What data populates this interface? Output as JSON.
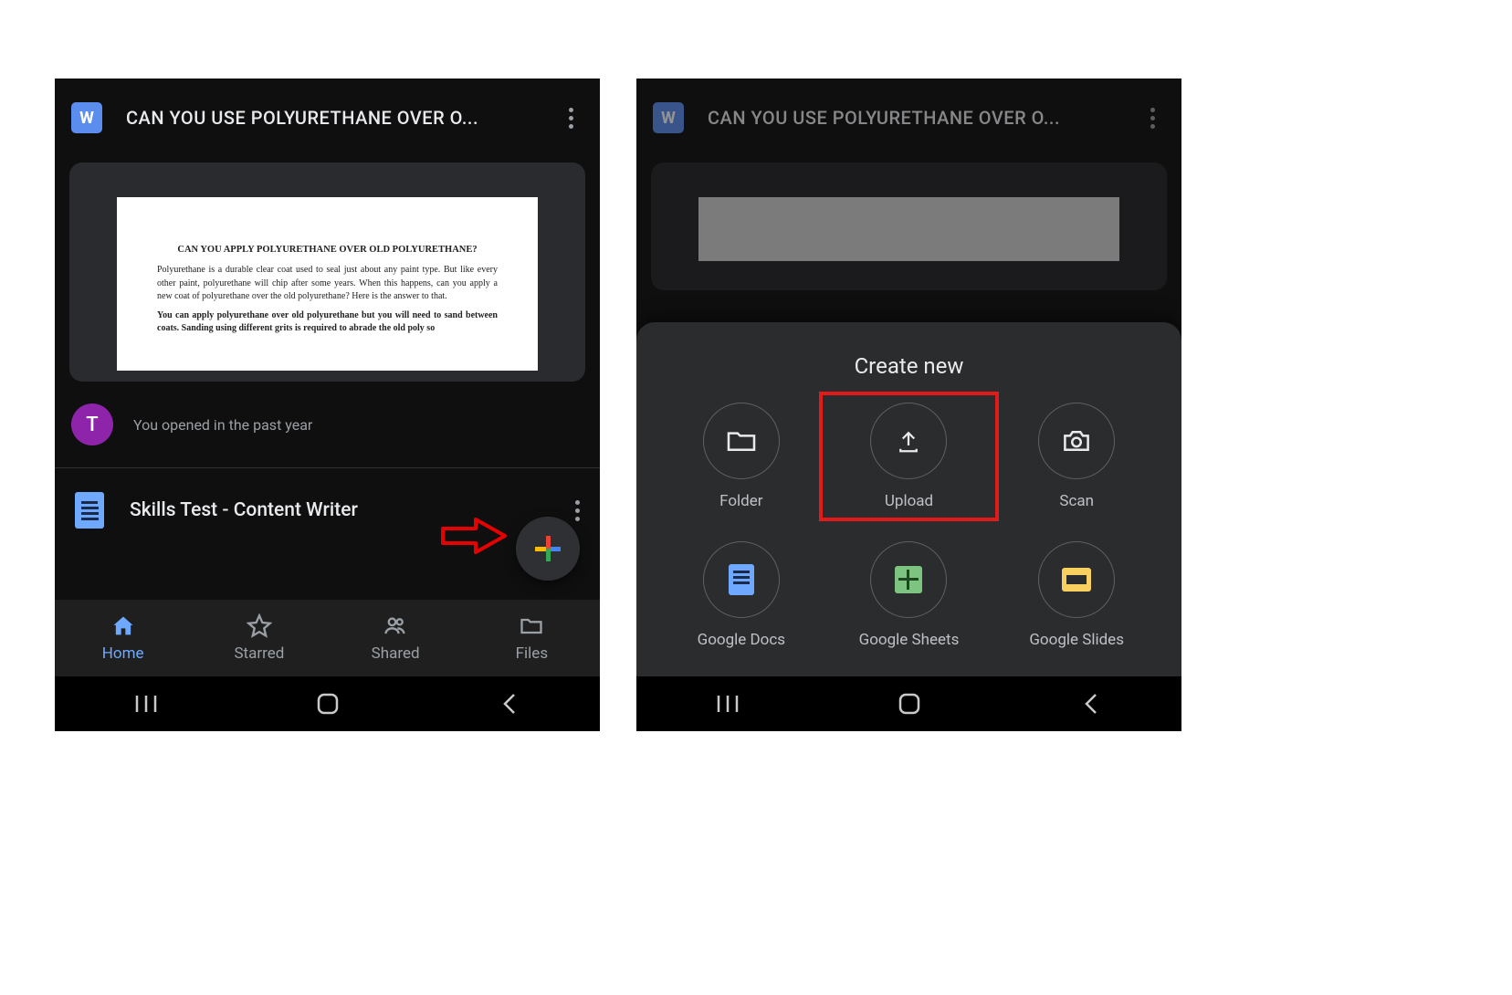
{
  "left": {
    "file_badge_letter": "W",
    "title": "CAN YOU USE POLYURETHANE OVER O...",
    "thumb": {
      "heading": "CAN YOU APPLY POLYURETHANE OVER OLD POLYURETHANE?",
      "p1": "Polyurethane is a durable clear coat used to seal just about any paint type. But like every other paint, polyurethane will chip after some years. When this happens, can you apply a new coat of polyurethane over the old polyurethane? Here is the answer to that.",
      "p2": "You can apply polyurethane over old polyurethane but you will need to sand between coats. Sanding using different grits is required to abrade the old poly so"
    },
    "avatar_letter": "T",
    "meta_text": "You opened in the past year",
    "file2": "Skills Test - Content Writer",
    "nav": {
      "home": "Home",
      "starred": "Starred",
      "shared": "Shared",
      "files": "Files"
    }
  },
  "right": {
    "file_badge_letter": "W",
    "title": "CAN YOU USE POLYURETHANE OVER O...",
    "sheet_title": "Create new",
    "options": {
      "folder": "Folder",
      "upload": "Upload",
      "scan": "Scan",
      "docs": "Google Docs",
      "sheets": "Google Sheets",
      "slides": "Google Slides"
    }
  }
}
